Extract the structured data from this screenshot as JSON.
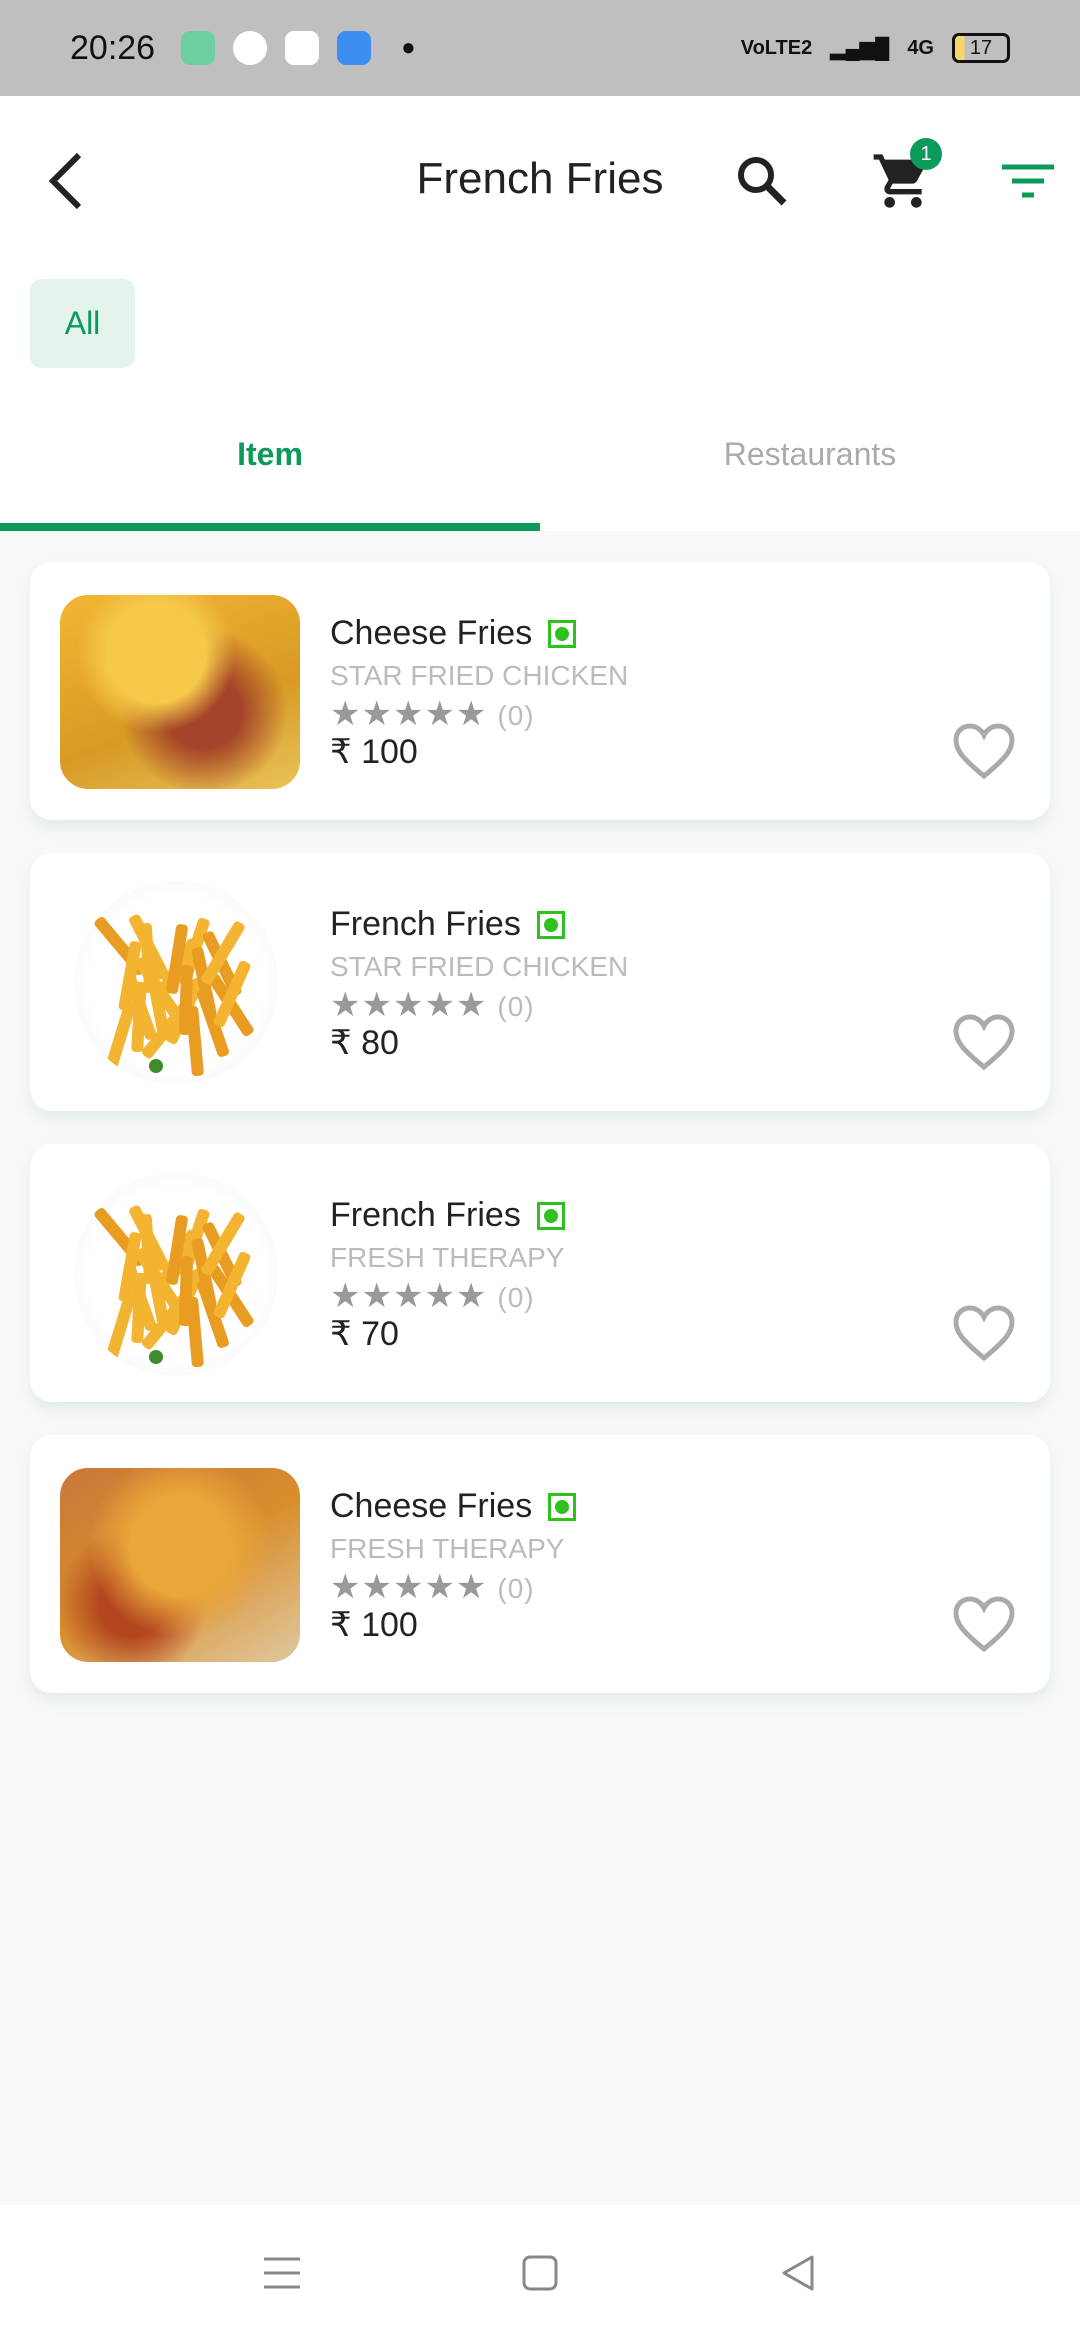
{
  "status_bar": {
    "time": "20:26",
    "network": "VoLTE2",
    "network2": "4G",
    "battery": "17"
  },
  "header": {
    "title": "French Fries",
    "cart_count": "1"
  },
  "filter_chips": [
    {
      "label": "All",
      "selected": true
    }
  ],
  "tabs": [
    {
      "label": "Item",
      "active": true
    },
    {
      "label": "Restaurants",
      "active": false
    }
  ],
  "items": [
    {
      "name": "Cheese Fries",
      "restaurant": "STAR FRIED CHICKEN",
      "rating": 0,
      "rating_count": "(0)",
      "price": "₹ 100",
      "veg": true,
      "image": "cheese-fries"
    },
    {
      "name": "French Fries",
      "restaurant": "STAR FRIED CHICKEN",
      "rating": 0,
      "rating_count": "(0)",
      "price": "₹ 80",
      "veg": true,
      "image": "french-fries"
    },
    {
      "name": "French Fries",
      "restaurant": "FRESH THERAPY",
      "rating": 0,
      "rating_count": "(0)",
      "price": "₹ 70",
      "veg": true,
      "image": "french-fries"
    },
    {
      "name": "Cheese Fries",
      "restaurant": "FRESH THERAPY",
      "rating": 0,
      "rating_count": "(0)",
      "price": "₹ 100",
      "veg": true,
      "image": "loaded-fries"
    }
  ],
  "colors": {
    "accent": "#0b9a5a",
    "veg": "#2fc21f"
  }
}
